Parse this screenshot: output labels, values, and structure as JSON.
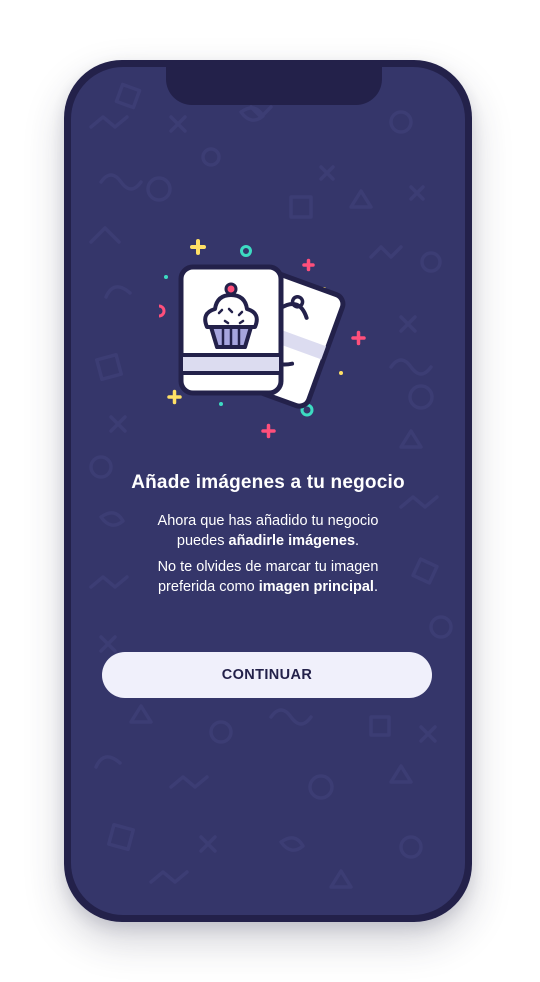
{
  "onboarding": {
    "title": "Añade imágenes a tu negocio",
    "paragraph1": {
      "line1": "Ahora que has añadido tu negocio",
      "line2_prefix": "puedes ",
      "line2_bold": "añadirle imágenes",
      "line2_suffix": "."
    },
    "paragraph2": {
      "line1": "No te olvides de marcar tu imagen",
      "line2_prefix": "preferida como ",
      "line2_bold": "imagen principal",
      "line2_suffix": "."
    },
    "continue_label": "CONTINUAR"
  },
  "illustration": {
    "icon": "cupcake-photo-cards-icon",
    "decorations": "confetti"
  },
  "colors": {
    "background": "#35366a",
    "frame": "#23214a",
    "button": "#f0f0fb",
    "button_text": "#23214a",
    "text": "#ffffff",
    "confetti_yellow": "#ffe066",
    "confetti_teal": "#3ddbc2",
    "confetti_pink": "#ff4f7b"
  }
}
